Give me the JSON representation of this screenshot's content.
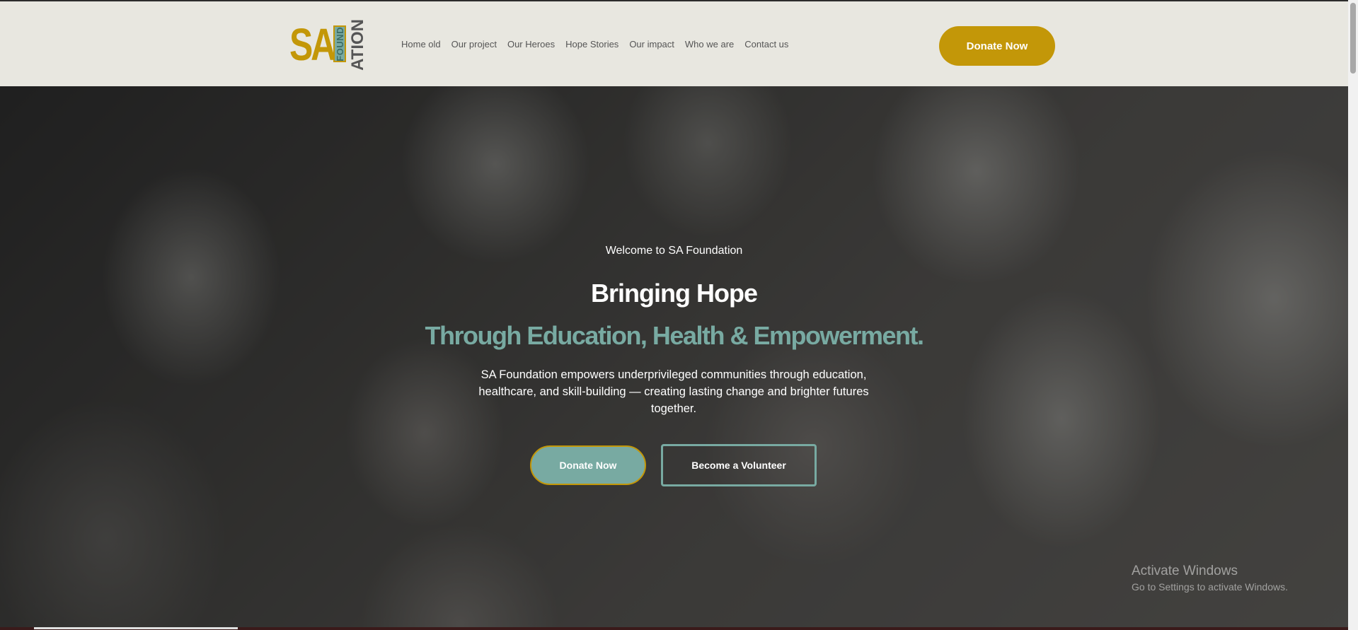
{
  "header": {
    "logo": {
      "sa": "SA",
      "found": "FOUND",
      "ation": "ATION"
    },
    "nav": [
      "Home old",
      "Our project",
      "Our Heroes",
      "Hope Stories",
      "Our impact",
      "Who we are",
      "Contact us"
    ],
    "donate_label": "Donate Now"
  },
  "hero": {
    "welcome": "Welcome to SA Foundation",
    "headline": "Bringing Hope",
    "subheadline": "Through Education, Health & Empowerment.",
    "description": "SA Foundation empowers underprivileged communities through education, healthcare, and skill-building — creating lasting change and brighter futures together.",
    "donate_label": "Donate Now",
    "volunteer_label": "Become a Volunteer"
  },
  "watermark": {
    "title": "Activate Windows",
    "subtitle": "Go to Settings to activate Windows."
  },
  "colors": {
    "gold": "#c39708",
    "teal": "#78aaa2",
    "header_bg": "#e8e7e0"
  }
}
